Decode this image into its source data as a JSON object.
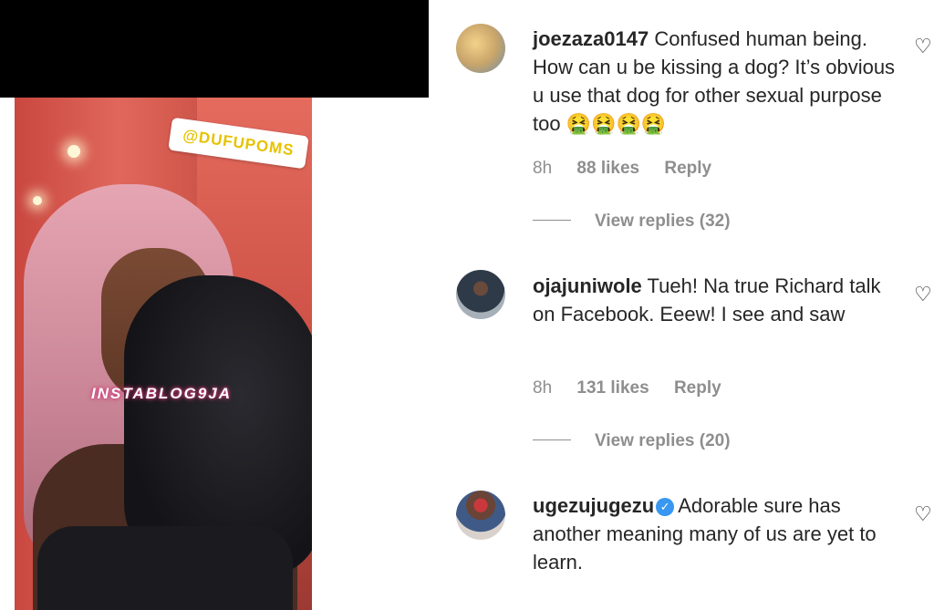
{
  "post": {
    "tag_text": "@DUFUPOMS",
    "watermark": "INSTABLOG9JA"
  },
  "comments": [
    {
      "username": "joezaza0147",
      "verified": false,
      "text": "Confused human being. How can u be kissing a dog? It’s obvious u use that dog for other sexual purpose too 🤮🤮🤮🤮",
      "time": "8h",
      "likes": "88 likes",
      "reply_label": "Reply",
      "view_replies": "View replies (32)"
    },
    {
      "username": "ojajuniwole",
      "verified": false,
      "text": "Tueh! Na true Richard talk on Facebook. Eeew! I see and saw",
      "time": "8h",
      "likes": "131 likes",
      "reply_label": "Reply",
      "view_replies": "View replies (20)"
    },
    {
      "username": "ugezujugezu",
      "verified": true,
      "text": "Adorable sure has another meaning many of us are yet to learn."
    }
  ],
  "icons": {
    "heart": "heart-icon",
    "verified": "verified-badge-icon"
  },
  "colors": {
    "text": "#262626",
    "muted": "#8e8e8e",
    "verified": "#3897f0"
  }
}
